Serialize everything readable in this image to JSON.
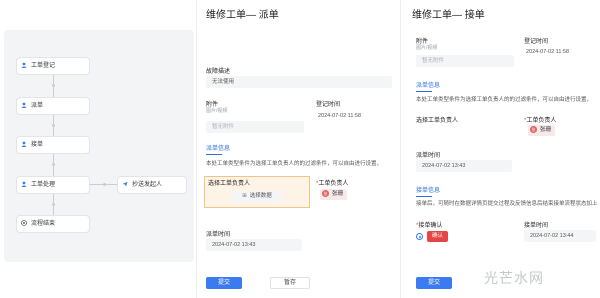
{
  "flow": {
    "nodes": [
      "工单登记",
      "派单",
      "接单",
      "工单处理",
      "流程结束"
    ],
    "side_node": "抄送发起人"
  },
  "dispatch": {
    "title": "维修工单— 派单",
    "fault_desc_label": "故障描述",
    "fault_desc_value": "无法使用",
    "attach_label": "附件",
    "attach_sub": "图片/视频",
    "attach_placeholder": "暂无附件",
    "reg_time_label": "登记时间",
    "reg_time_value": "2024-07-02 11:58",
    "section": "派单信息",
    "section_desc": "本处工单类型条件为选择工单负责人的的过滤条件，可以自由进行设置，",
    "select_owner_label": "选择工单负责人",
    "select_data_btn": "选择数据",
    "owner_label": "工单负责人",
    "owner_name": "张珊",
    "owner_avatar": "张",
    "dispatch_time_label": "派单时间",
    "dispatch_time_value": "2024-07-02 13:43",
    "submit": "提交",
    "save": "暂存"
  },
  "accept": {
    "title": "维修工单— 接单",
    "attach_label": "附件",
    "attach_sub": "图片/视频",
    "attach_placeholder": "暂无附件",
    "reg_time_label": "登记时间",
    "reg_time_value": "2024-07-02 11:58",
    "section1": "派单信息",
    "section1_desc": "本处工单类型条件为选择工单负责人的的过滤条件，可以自由进行设置，",
    "select_owner_label": "选择工单负责人",
    "owner_label": "工单负责人",
    "owner_name": "张珊",
    "owner_avatar": "张",
    "dispatch_time_label": "派单时间",
    "dispatch_time_value": "2024-07-02 13:43",
    "section2": "接单信息",
    "section2_desc": "接单后，可随时在数据详情页提交过程及反馈信息后结束接单流程状态加上",
    "confirm_label": "接单确认",
    "confirm_value": "确认",
    "accept_time_label": "接单时间",
    "accept_time_value": "2024-07-02 13:44",
    "submit": "提交"
  },
  "watermark": "光芒水网",
  "colors": {
    "accent": "#3b7bf0",
    "danger": "#e64545",
    "highlight": "#f0c487"
  }
}
